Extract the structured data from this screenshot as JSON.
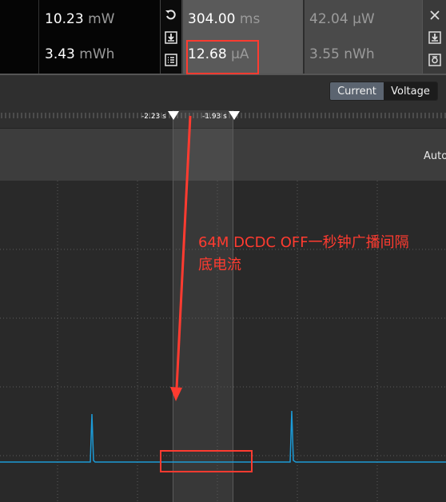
{
  "stats": {
    "power_value": "10.23",
    "power_unit": "mW",
    "energy_value": "3.43",
    "energy_unit": "mWh",
    "duration_value": "304.00",
    "duration_unit": "ms",
    "current_value": "12.68",
    "current_unit": "µA",
    "avg_power_value": "42.04",
    "avg_power_unit": "µW",
    "avg_energy_value": "3.55",
    "avg_energy_unit": "nWh"
  },
  "toggle": {
    "current_label": "Current",
    "voltage_label": "Voltage",
    "active": "Current"
  },
  "markers": {
    "left_label": "-2.23 s",
    "right_label": "-1.93 s"
  },
  "chart_header": {
    "auto_label": "Auto"
  },
  "annotation": {
    "line1": "64M DCDC OFF一秒钟广播间隔",
    "line2": "底电流"
  },
  "colors": {
    "trace": "#1c9ad6",
    "annotation": "#ff3b30",
    "selection": "#4a4a4a"
  },
  "icons": {
    "reset": "undo-icon",
    "export": "download-icon",
    "log": "list-icon",
    "close": "close-icon",
    "save": "download-icon",
    "screenshot": "camera-icon"
  }
}
